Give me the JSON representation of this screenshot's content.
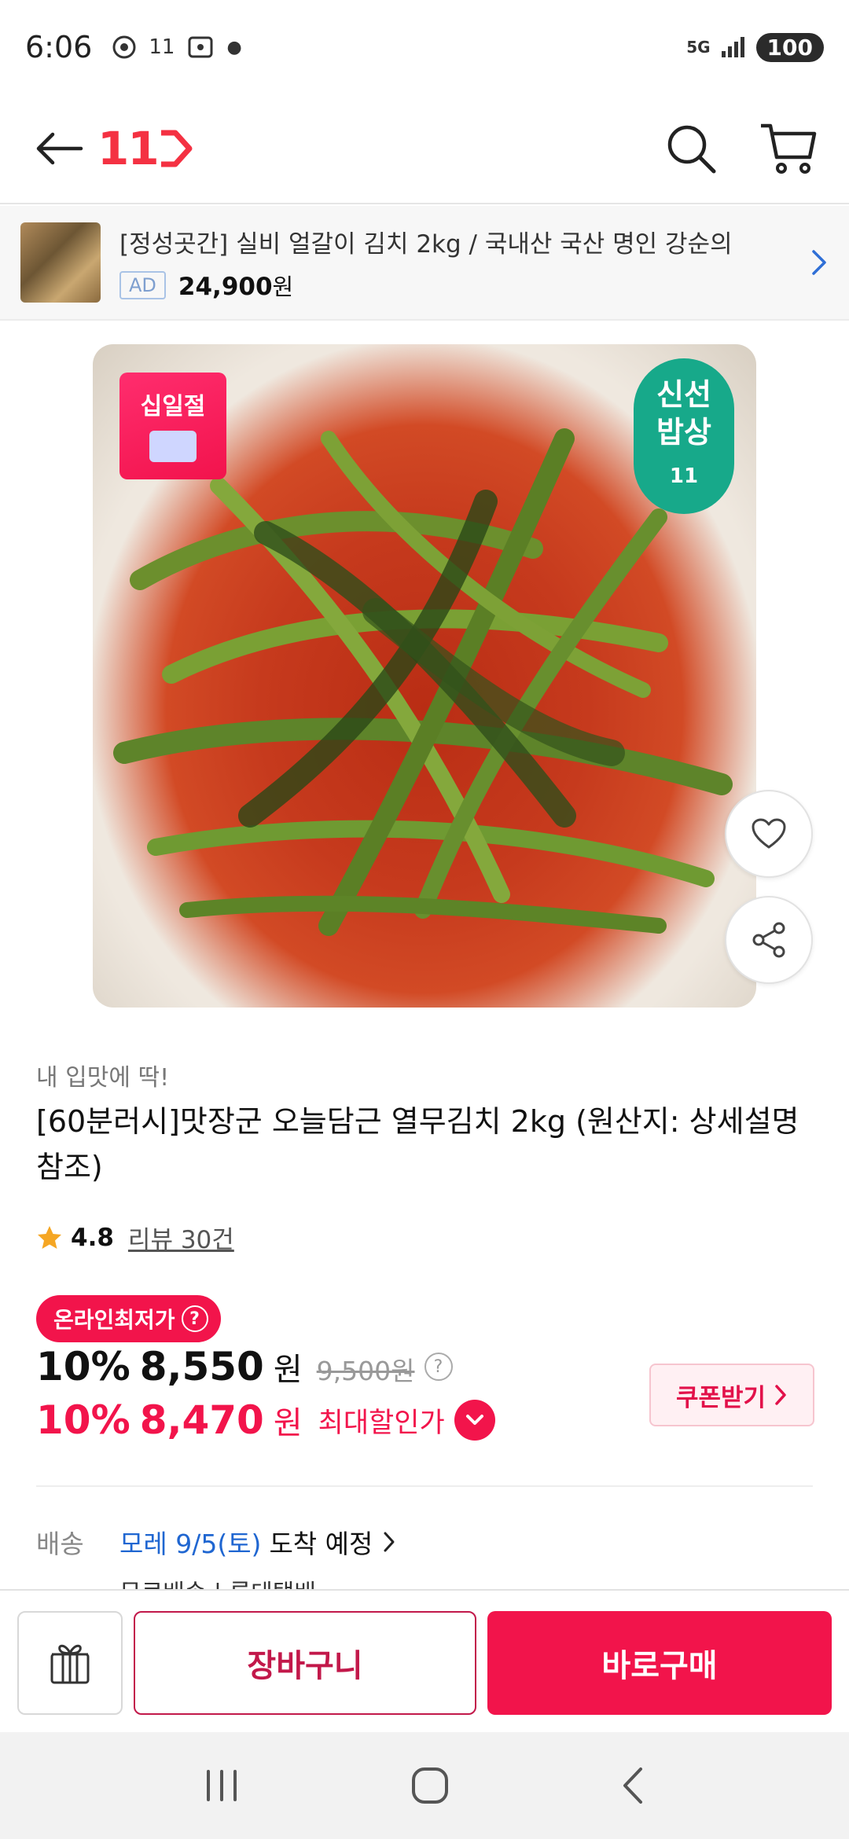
{
  "status_bar": {
    "time": "6:06",
    "network": "5G",
    "battery": "100",
    "app_icon_label": "11"
  },
  "top_nav": {
    "logo_text": "11"
  },
  "ad_banner": {
    "title": "[정성곳간] 실비 얼갈이 김치 2kg / 국내산 국산 명인 강순의",
    "badge": "AD",
    "price": "24,900",
    "price_unit": "원"
  },
  "product_image": {
    "badge_left": "십일절",
    "badge_right_line1": "신선",
    "badge_right_line2": "밥상",
    "badge_right_logo": "11"
  },
  "product": {
    "subcopy": "내 입맛에 딱!",
    "title": "[60분러시]맛장군 오늘담근 열무김치 2kg (원산지: 상세설명 참조)",
    "rating": "4.8",
    "reviews": "리뷰 30건"
  },
  "pricing": {
    "lowest_badge": "온라인최저가",
    "discount1": "10%",
    "price1": "8,550",
    "unit": "원",
    "original_price": "9,500원",
    "discount2": "10%",
    "price2": "8,470",
    "max_discount_label": "최대할인가",
    "coupon_label": "쿠폰받기"
  },
  "delivery": {
    "label": "배송",
    "date": "모레 9/5(토)",
    "suffix": "도착 예정",
    "sub": "무료배송 | 롯데택배"
  },
  "bottom_bar": {
    "cart_label": "장바구니",
    "buy_label": "바로구매"
  },
  "colors": {
    "brand": "#f43142",
    "accent": "#f2144b",
    "link_blue": "#1f66d1",
    "fresh_green": "#17a98a"
  },
  "icons": [
    "back-arrow-icon",
    "search-icon",
    "cart-icon",
    "chevron-right-icon",
    "heart-icon",
    "share-icon",
    "star-icon",
    "gift-icon",
    "recents-icon",
    "home-icon",
    "back-icon"
  ]
}
